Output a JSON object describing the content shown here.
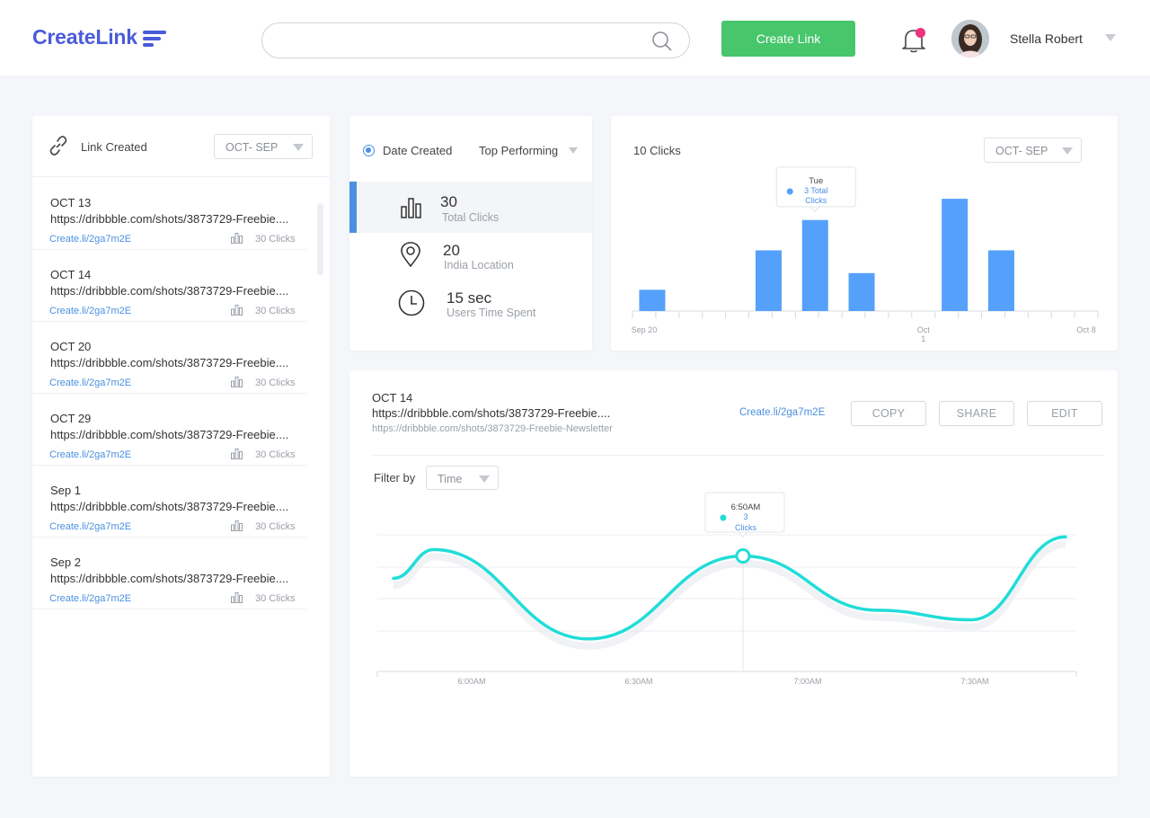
{
  "header": {
    "logo": "CreateLink",
    "search_placeholder": "",
    "create_button": "Create Link",
    "user_name": "Stella Robert",
    "accent": "#4a5bd8",
    "create_color": "#47c66c",
    "notification_dot_color": "#f0327a"
  },
  "links_panel": {
    "title": "Link Created",
    "range": "OCT- SEP",
    "items": [
      {
        "date": "OCT 13",
        "url": "https://dribbble.com/shots/3873729-Freebie....",
        "short": "Create.li/2ga7m2E",
        "clicks": "30 Clicks"
      },
      {
        "date": "OCT 14",
        "url": "https://dribbble.com/shots/3873729-Freebie....",
        "short": "Create.li/2ga7m2E",
        "clicks": "30 Clicks"
      },
      {
        "date": "OCT 20",
        "url": "https://dribbble.com/shots/3873729-Freebie....",
        "short": "Create.li/2ga7m2E",
        "clicks": "30 Clicks"
      },
      {
        "date": "OCT 29",
        "url": "https://dribbble.com/shots/3873729-Freebie....",
        "short": "Create.li/2ga7m2E",
        "clicks": "30 Clicks"
      },
      {
        "date": "Sep 1",
        "url": "https://dribbble.com/shots/3873729-Freebie....",
        "short": "Create.li/2ga7m2E",
        "clicks": "30 Clicks"
      },
      {
        "date": "Sep 2",
        "url": "https://dribbble.com/shots/3873729-Freebie....",
        "short": "Create.li/2ga7m2E",
        "clicks": "30 Clicks"
      }
    ]
  },
  "stats": {
    "date_created": "Date Created",
    "top_performing": "Top Performing",
    "rows": [
      {
        "value": "30",
        "label": "Total Clicks",
        "icon": "bar-chart-icon"
      },
      {
        "value": "20",
        "label": "India Location",
        "icon": "location-pin-icon"
      },
      {
        "value": "15 sec",
        "label": "Users Time Spent",
        "icon": "clock-icon"
      }
    ]
  },
  "bar_chart": {
    "title": "10 Clicks",
    "range": "OCT- SEP",
    "tooltip_day": "Tue",
    "tooltip_value": "3",
    "tooltip_label": "Total Clicks",
    "color": "#55a0fb"
  },
  "details": {
    "date": "OCT 14",
    "url": "https://dribbble.com/shots/3873729-Freebie....",
    "url_full": "https://dribbble.com/shots/3873729-Freebie-Newsletter",
    "short": "Create.li/2ga7m2E",
    "copy": "COPY",
    "share": "SHARE",
    "edit": "EDIT",
    "filter_label": "Filter by",
    "filter_value": "Time",
    "tooltip_time": "6:50AM",
    "tooltip_value": "3",
    "tooltip_label": "Clicks",
    "line_color": "#22dcd8"
  },
  "chart_data": [
    {
      "type": "bar",
      "title": "10 Clicks",
      "x_tick_labels": [
        "Sep 20",
        "Oct 1",
        "Oct 8"
      ],
      "slots": 20,
      "bars": [
        {
          "slot": 0,
          "value": 0.7
        },
        {
          "slot": 5,
          "value": 2
        },
        {
          "slot": 7,
          "value": 3
        },
        {
          "slot": 9,
          "value": 1.25
        },
        {
          "slot": 13,
          "value": 3.7
        },
        {
          "slot": 15,
          "value": 2
        }
      ],
      "highlighted_slot": 7,
      "ylim": [
        0,
        4
      ]
    },
    {
      "type": "line",
      "x_tick_labels": [
        "6:00AM",
        "6:30AM",
        "7:00AM",
        "7:30AM"
      ],
      "x": [
        0,
        0.06,
        0.29,
        0.52,
        0.72,
        0.86,
        1.0
      ],
      "values": [
        2.3,
        3.2,
        0.4,
        3.0,
        1.3,
        1.0,
        3.6
      ],
      "highlight_index": 3,
      "ylim": [
        0,
        4
      ],
      "grid": true
    }
  ]
}
